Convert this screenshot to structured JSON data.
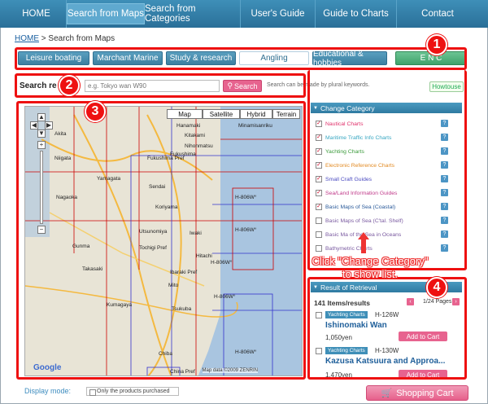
{
  "topnav": {
    "items": [
      {
        "label": "HOME"
      },
      {
        "label": "Search from Maps"
      },
      {
        "label": "Search from Categories"
      },
      {
        "label": "User's Guide"
      },
      {
        "label": "Guide to Charts"
      },
      {
        "label": "Contact"
      }
    ],
    "active_index": 1
  },
  "breadcrumb": {
    "home": "HOME",
    "sep": " > ",
    "current": "Search from Maps"
  },
  "categories": [
    {
      "label": "Leisure boating"
    },
    {
      "label": "Marchant Marine"
    },
    {
      "label": "Study & research"
    },
    {
      "label": "Angling"
    },
    {
      "label": "Educational & hobbies"
    },
    {
      "label": "E N C"
    }
  ],
  "search": {
    "label": "Search re",
    "label_tail": "t",
    "placeholder": "e.g. Tokyo wan W90",
    "button": "Search",
    "note": "Search can be made by plural keywords.",
    "howto": "Howtouse"
  },
  "map": {
    "types": [
      "Map",
      "Satellite",
      "Hybrid",
      "Terrain"
    ],
    "labels": [
      {
        "text": "Akita"
      },
      {
        "text": "Kitakami"
      },
      {
        "text": "Hanamaki"
      },
      {
        "text": "Minamisanriku"
      },
      {
        "text": "Nihonmatsu"
      },
      {
        "text": "Yamagata"
      },
      {
        "text": "Sendai"
      },
      {
        "text": "Fukushima"
      },
      {
        "text": "Niigata"
      },
      {
        "text": "Koriyama"
      },
      {
        "text": "Iwaki"
      },
      {
        "text": "Nagaoka"
      },
      {
        "text": "Utsunomiya"
      },
      {
        "text": "Mito"
      },
      {
        "text": "Hitachi"
      },
      {
        "text": "Tsukuba"
      },
      {
        "text": "Chiba"
      },
      {
        "text": "Takasaki"
      },
      {
        "text": "Kumagaya"
      },
      {
        "text": "Tochigi Pref"
      },
      {
        "text": "Ibaraki Pref"
      },
      {
        "text": "Gunma"
      },
      {
        "text": "Fukushima Pref"
      },
      {
        "text": "H-806W°"
      },
      {
        "text": "H-806W°"
      },
      {
        "text": "H-806W°"
      },
      {
        "text": "H-806W°"
      },
      {
        "text": "H-806W°"
      }
    ],
    "copyright": "Map data ©2009 ZENRIN",
    "google": "Google",
    "china": "China Pref"
  },
  "change_category": {
    "title": "Change Category",
    "items": [
      {
        "label": "Nautical Charts",
        "checked": true,
        "color": "#e0306a"
      },
      {
        "label": "Maritime Traffic Info Charts",
        "checked": true,
        "color": "#37a7c2"
      },
      {
        "label": "Yachting Charts",
        "checked": true,
        "color": "#3a9a3a"
      },
      {
        "label": "Electronic Reference Charts",
        "checked": true,
        "color": "#e28a22"
      },
      {
        "label": "Small Craft Guides",
        "checked": true,
        "color": "#4a4ac0"
      },
      {
        "label": "Sea/Land Information Guides",
        "checked": true,
        "color": "#c03a8a"
      },
      {
        "label": "Basic Maps of Sea (Coastal)",
        "checked": true,
        "color": "#2a5a9a"
      },
      {
        "label": "Basic Maps of Sea (C'tal. Shelf)",
        "checked": false,
        "color": "#7a5aa0"
      },
      {
        "label": "Basic Ma  of the Sea in Oceans",
        "checked": false,
        "color": "#7a5aa0"
      },
      {
        "label": "Bathymetric Charts",
        "checked": false,
        "color": "#7a5aa0"
      }
    ]
  },
  "results": {
    "title": "Result of Retrieval",
    "count": "141 Items/results",
    "page": "1/24 Pages",
    "items": [
      {
        "tag": "Yachting Charts",
        "code": "H-126W",
        "name": "Ishinomaki Wan",
        "price": "1,050yen",
        "cart": "Add to Cart"
      },
      {
        "tag": "Yachting Charts",
        "code": "H-130W",
        "name": "Kazusa Katsuura and Approa...",
        "price": "1,470yen",
        "cart": "Add to Cart"
      }
    ]
  },
  "callout": {
    "line1": "Click \"Change Category\"",
    "line2": "to show list."
  },
  "badges": [
    "1",
    "2",
    "3",
    "4"
  ],
  "footer": {
    "display_mode": "Display mode:",
    "only_purchased": "Only the products purchased",
    "shopping_cart": "Shopping Cart"
  }
}
